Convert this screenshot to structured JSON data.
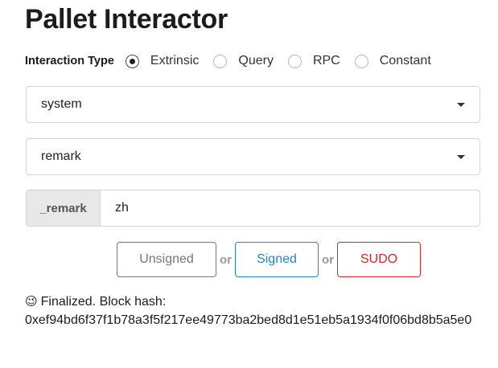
{
  "title": "Pallet Interactor",
  "interaction_type": {
    "label": "Interaction Type",
    "options": [
      {
        "label": "Extrinsic",
        "checked": true
      },
      {
        "label": "Query",
        "checked": false
      },
      {
        "label": "RPC",
        "checked": false
      },
      {
        "label": "Constant",
        "checked": false
      }
    ]
  },
  "pallet_dropdown": {
    "value": "system"
  },
  "callable_dropdown": {
    "value": "remark"
  },
  "param": {
    "label": "_remark",
    "value": "zh"
  },
  "buttons": {
    "unsigned": "Unsigned",
    "or_1": "or",
    "signed": "Signed",
    "or_2": "or",
    "sudo": "SUDO"
  },
  "status": {
    "icon": "😉",
    "icon_name": "winking-face-icon",
    "text": "Finalized. Block hash:",
    "hash": "0xef94bd6f37f1b78a3f5f217ee49773ba2bed8d1e51eb5a1934f0f06bd8b5a5e0"
  },
  "colors": {
    "signed": "#2185d0",
    "sudo": "#db2828",
    "unsigned": "#767676"
  }
}
